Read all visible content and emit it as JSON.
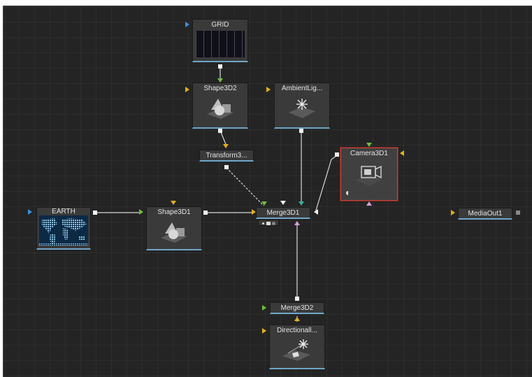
{
  "flow": {
    "nodes": {
      "grid": {
        "label": "GRID",
        "icon": "grid-thumbnail-icon"
      },
      "shape3d2": {
        "label": "Shape3D2",
        "icon": "shape3d-icon"
      },
      "ambient": {
        "label": "AmbientLig...",
        "icon": "ambient-light-icon"
      },
      "transform": {
        "label": "Transform3..."
      },
      "camera": {
        "label": "Camera3D1",
        "icon": "camera-icon"
      },
      "earth": {
        "label": "EARTH",
        "icon": "earth-map-thumbnail-icon"
      },
      "shape3d1": {
        "label": "Shape3D1",
        "icon": "shape3d-icon"
      },
      "merge3d1": {
        "label": "Merge3D1"
      },
      "mediaout": {
        "label": "MediaOut1"
      },
      "merge3d2": {
        "label": "Merge3D2"
      },
      "directional": {
        "label": "Directionall...",
        "icon": "directional-light-icon"
      }
    }
  },
  "colors": {
    "background": "#242424",
    "node": "#3a3a3a",
    "node_underline": "#6fa6c8",
    "selected_outline": "#c6463b",
    "port_input": "#e0b020",
    "port_main": "#3d8fd6",
    "port_green": "#6cbf3c",
    "port_pink": "#d8a0d8"
  }
}
